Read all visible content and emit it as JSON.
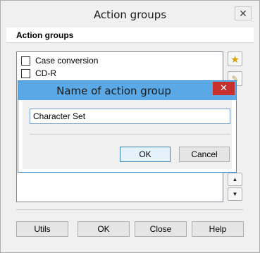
{
  "outer": {
    "title": "Action groups",
    "close_label": "✕",
    "header_label": "Action groups",
    "list_items": [
      {
        "label": "Case conversion",
        "checked": false
      },
      {
        "label": "CD-R",
        "checked": false
      }
    ],
    "side_buttons": {
      "new_icon": "star-icon",
      "edit_icon": "edit-icon",
      "up_label": "▲",
      "down_label": "▼"
    },
    "buttons": {
      "utils": "Utils",
      "ok": "OK",
      "close": "Close",
      "help": "Help"
    }
  },
  "inner": {
    "title": "Name of action group",
    "close_label": "✕",
    "input_value": "Character Set",
    "ok": "OK",
    "cancel": "Cancel"
  },
  "colors": {
    "inner_titlebar": "#5aa9e6",
    "inner_close": "#c7302c",
    "window_bg": "#f0f0f0"
  }
}
